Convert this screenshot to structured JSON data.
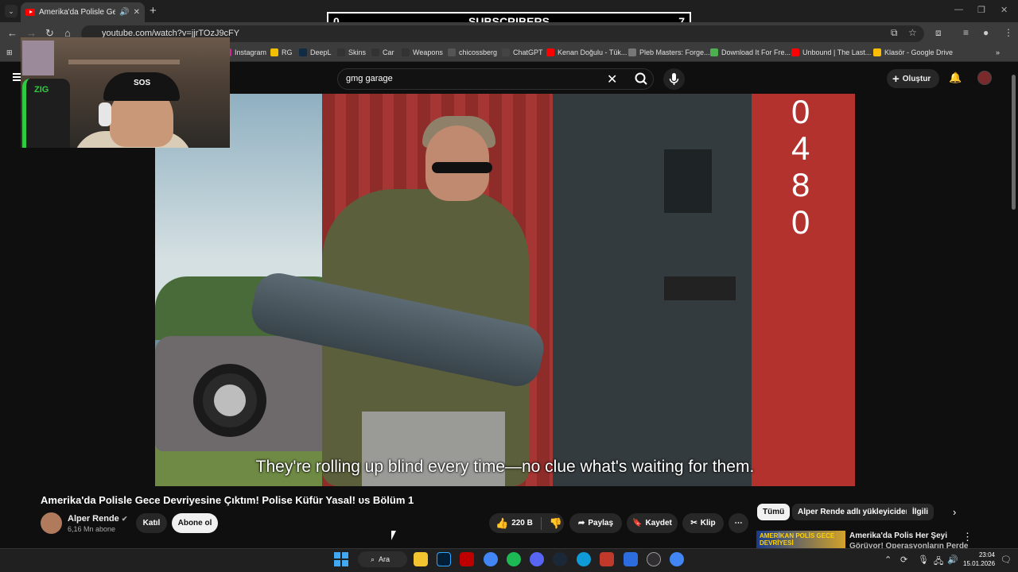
{
  "browser": {
    "tab_title": "Amerika'da Polisle Gece De",
    "url": "youtube.com/watch?v=jjrTOzJ9cFY",
    "new_tab": "+",
    "bookmarks": [
      {
        "label": "Instagram",
        "color": "#d6249f"
      },
      {
        "label": "RG",
        "color": "#f0c000"
      },
      {
        "label": "DeepL",
        "color": "#0f2b46"
      },
      {
        "label": "Skins",
        "color": "#333333"
      },
      {
        "label": "Car",
        "color": "#333333"
      },
      {
        "label": "Weapons",
        "color": "#333333"
      },
      {
        "label": "chicossberg",
        "color": "#555555"
      },
      {
        "label": "ChatGPT",
        "color": "#444444"
      },
      {
        "label": "Kenan Doğulu - Tük...",
        "color": "#ff0000"
      },
      {
        "label": "Pleb Masters: Forge...",
        "color": "#777777"
      },
      {
        "label": "Download It For Fre...",
        "color": "#4caf50"
      },
      {
        "label": "Unbound | The Last...",
        "color": "#ff0000"
      },
      {
        "label": "Klasör - Google Drive",
        "color": "#fbbc04"
      }
    ]
  },
  "overlay": {
    "left": "0",
    "label": "SUBSCRIBERS",
    "right": "7"
  },
  "youtube": {
    "search_query": "gmg garage",
    "create_label": "Oluştur",
    "subtitle": "They're rolling up blind every time—no clue what's waiting for them.",
    "container_numbers": [
      "0",
      "4",
      "8",
      "0"
    ],
    "title": "Amerika'da Polisle Gece Devriyesine Çıktım! Polise Küfür Yasal! υs Bölüm 1",
    "channel": {
      "name": "Alper Rende",
      "subs": "6,16 Mn abone"
    },
    "buttons": {
      "join": "Katıl",
      "subscribe": "Abone ol",
      "likes": "220 B",
      "share": "Paylaş",
      "save": "Kaydet",
      "clip": "Klip",
      "more": "⋯"
    },
    "chips": [
      "Tümü",
      "Alper Rende adlı yükleyiciden",
      "İlgili"
    ],
    "recommendation": {
      "thumb_text": "AMERİKAN POLİS GECE DEVRİYESİ",
      "title": "Amerika'da Polis Her Şeyi",
      "title_line2": "Görüyor! Operasyonların Perde"
    }
  },
  "taskbar": {
    "search_label": "Ara",
    "time": "23:04",
    "date": "15.01.2026",
    "apps": [
      {
        "name": "explorer",
        "color": "#f4c430"
      },
      {
        "name": "photoshop",
        "color": "#001e36"
      },
      {
        "name": "filezilla",
        "color": "#bf0000"
      },
      {
        "name": "chrome",
        "color": "#4285f4"
      },
      {
        "name": "spotify",
        "color": "#1db954"
      },
      {
        "name": "discord",
        "color": "#5865f2"
      },
      {
        "name": "steam",
        "color": "#1b2838"
      },
      {
        "name": "edge",
        "color": "#0f9bd7"
      },
      {
        "name": "video-app",
        "color": "#c0392b"
      },
      {
        "name": "vpn",
        "color": "#2d6cdf"
      },
      {
        "name": "obs",
        "color": "#302e31"
      },
      {
        "name": "chrome-profile",
        "color": "#4285f4"
      }
    ]
  }
}
